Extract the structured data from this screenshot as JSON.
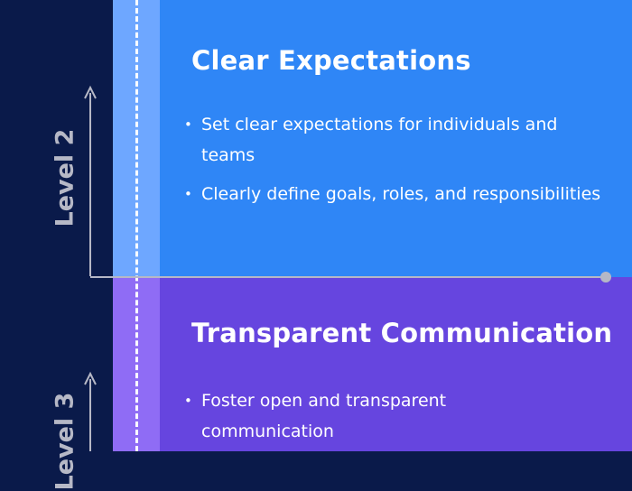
{
  "levels": [
    {
      "label": "Level 2",
      "title": "Clear Expectations",
      "bullets": [
        "Set clear expectations for individuals and teams",
        "Clearly define goals, roles, and responsibilities"
      ],
      "panel_color": "#2f86f6",
      "strip_color": "#6ea7ff"
    },
    {
      "label": "Level 3",
      "title": "Transparent Communication",
      "bullets": [
        "Foster open and transparent communication"
      ],
      "panel_color": "#6645df",
      "strip_color": "#8f6cf5"
    }
  ],
  "colors": {
    "background": "#0a1a4a",
    "axis": "#b6b8c6",
    "text": "#ffffff"
  }
}
